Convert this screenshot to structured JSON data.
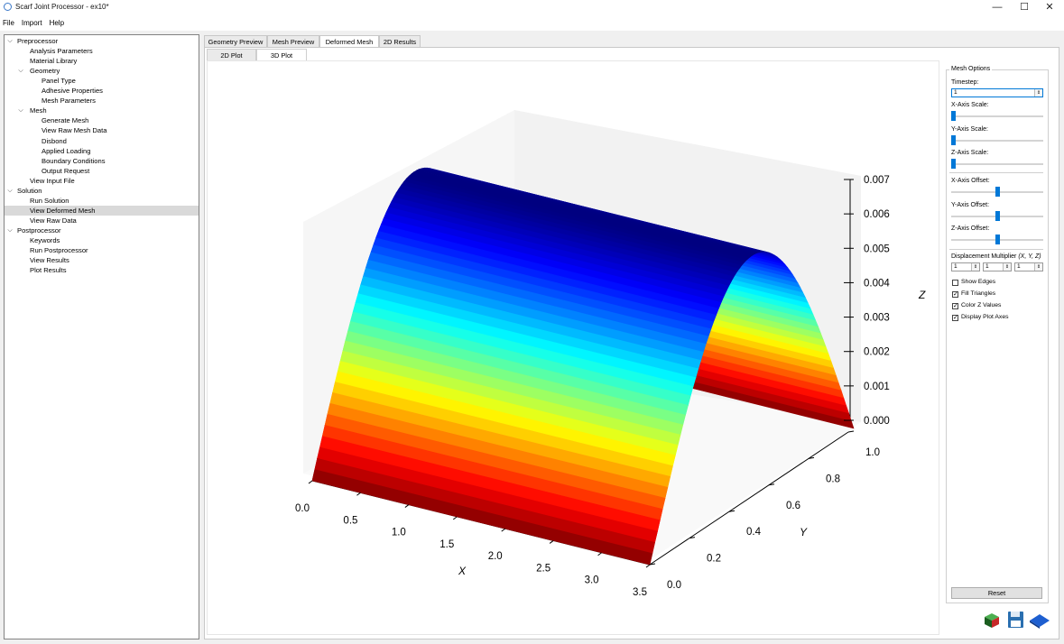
{
  "window": {
    "title": "Scarf Joint Processor - ex10*",
    "minimize": "—",
    "maximize": "☐",
    "close": "✕"
  },
  "menu": [
    "File",
    "Import",
    "Help"
  ],
  "tree": [
    {
      "label": "Preprocessor",
      "level": 0,
      "expanded": true
    },
    {
      "label": "Analysis Parameters",
      "level": 2
    },
    {
      "label": "Material Library",
      "level": 2
    },
    {
      "label": "Geometry",
      "level": 1,
      "expanded": true
    },
    {
      "label": "Panel Type",
      "level": 3
    },
    {
      "label": "Adhesive Properties",
      "level": 3
    },
    {
      "label": "Mesh Parameters",
      "level": 3
    },
    {
      "label": "Mesh",
      "level": 1,
      "expanded": true
    },
    {
      "label": "Generate Mesh",
      "level": 3
    },
    {
      "label": "View Raw Mesh Data",
      "level": 3
    },
    {
      "label": "Disbond",
      "level": 3
    },
    {
      "label": "Applied Loading",
      "level": 3
    },
    {
      "label": "Boundary Conditions",
      "level": 3
    },
    {
      "label": "Output Request",
      "level": 3
    },
    {
      "label": "View Input File",
      "level": 2
    },
    {
      "label": "Solution",
      "level": 0,
      "expanded": true
    },
    {
      "label": "Run Solution",
      "level": 2
    },
    {
      "label": "View Deformed Mesh",
      "level": 2,
      "selected": true
    },
    {
      "label": "View Raw Data",
      "level": 2
    },
    {
      "label": "Postprocessor",
      "level": 0,
      "expanded": true
    },
    {
      "label": "Keywords",
      "level": 2
    },
    {
      "label": "Run Postprocessor",
      "level": 2
    },
    {
      "label": "View Results",
      "level": 2
    },
    {
      "label": "Plot Results",
      "level": 2
    }
  ],
  "tabs": [
    "Geometry Preview",
    "Mesh Preview",
    "Deformed Mesh",
    "2D Results"
  ],
  "active_tab": "Deformed Mesh",
  "subtabs": [
    "2D Plot",
    "3D Plot"
  ],
  "active_subtab": "3D Plot",
  "options": {
    "title": "Mesh Options",
    "timestep_label": "Timestep:",
    "timestep_value": "1",
    "x_scale_label": "X-Axis Scale:",
    "y_scale_label": "Y-Axis Scale:",
    "z_scale_label": "Z-Axis Scale:",
    "x_offset_label": "X-Axis Offset:",
    "y_offset_label": "Y-Axis Offset:",
    "z_offset_label": "Z-Axis Offset:",
    "disp_label": "Displacement Multiplier",
    "disp_axes": "(X, Y, Z)",
    "disp_x": "1",
    "disp_y": "1",
    "disp_z": "1",
    "scale_levels": [
      0,
      0,
      0
    ],
    "offset_levels": [
      0.5,
      0.5,
      0.5
    ],
    "checkboxes": [
      {
        "label": "Show Edges",
        "checked": false
      },
      {
        "label": "Fill Triangles",
        "checked": true
      },
      {
        "label": "Color Z Values",
        "checked": true
      },
      {
        "label": "Display Plot Axes",
        "checked": true
      }
    ],
    "reset": "Reset"
  },
  "toolbar_icons": [
    "box-icon",
    "save-icon",
    "plane-icon"
  ],
  "chart_data": {
    "type": "surface",
    "function": "z = 0.007 * sin(pi * y), x in [0, 3.5], y in [0, 1]",
    "x": [
      0.0,
      0.5,
      1.0,
      1.5,
      2.0,
      2.5,
      3.0,
      3.5
    ],
    "y": [
      0.0,
      0.1,
      0.2,
      0.3,
      0.4,
      0.5,
      0.6,
      0.7,
      0.8,
      0.9,
      1.0
    ],
    "z_profile_over_y": [
      0.0,
      0.00216,
      0.00411,
      0.00566,
      0.00666,
      0.007,
      0.00666,
      0.00566,
      0.00411,
      0.00216,
      0.0
    ],
    "x_ticks": [
      "0.0",
      "0.5",
      "1.0",
      "1.5",
      "2.0",
      "2.5",
      "3.0",
      "3.5"
    ],
    "y_ticks": [
      "0.0",
      "0.2",
      "0.4",
      "0.6",
      "0.8",
      "1.0"
    ],
    "z_ticks": [
      "0.000",
      "0.001",
      "0.002",
      "0.003",
      "0.004",
      "0.005",
      "0.006",
      "0.007"
    ],
    "xlabel": "X",
    "ylabel": "Y",
    "zlabel": "Z",
    "xlim": [
      0,
      3.5
    ],
    "ylim": [
      0,
      1
    ],
    "zlim": [
      0,
      0.007
    ],
    "colormap": "jet",
    "grid": false
  }
}
